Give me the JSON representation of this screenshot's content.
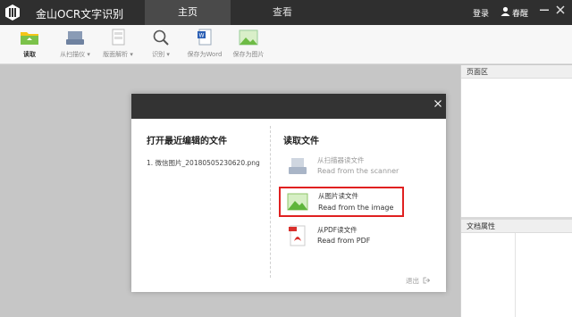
{
  "app": {
    "title": "金山OCR文字识别",
    "tabs": [
      {
        "label": "主页",
        "active": true
      },
      {
        "label": "查看",
        "active": false
      }
    ],
    "login_label": "登录",
    "username": "春醒"
  },
  "toolbar": {
    "items": [
      {
        "label": "读取",
        "icon": "folder-icon",
        "active": true
      },
      {
        "label": "从扫描仪",
        "icon": "scanner-icon",
        "dropdown": true
      },
      {
        "label": "版面解析",
        "icon": "layout-icon",
        "dropdown": true
      },
      {
        "label": "识别",
        "icon": "search-icon",
        "dropdown": true
      },
      {
        "label": "保存为Word",
        "icon": "word-icon"
      },
      {
        "label": "保存为图片",
        "icon": "image-icon"
      }
    ]
  },
  "right_panel": {
    "pages_title": "页面区",
    "props_title": "文档属性"
  },
  "dialog": {
    "recent_title": "打开最近编辑的文件",
    "recent_files": [
      "1.  微信图片_20180505230620.png"
    ],
    "read_title": "读取文件",
    "options": [
      {
        "cn": "从扫描器读文件",
        "en": "Read from the scanner",
        "icon": "scanner-icon",
        "enabled": false
      },
      {
        "cn": "从图片读文件",
        "en": "Read from the image",
        "icon": "image-icon",
        "highlighted": true
      },
      {
        "cn": "从PDF读文件",
        "en": "Read from PDF",
        "icon": "pdf-icon"
      }
    ],
    "exit_label": "退出"
  },
  "colors": {
    "titlebar": "#2f2f2f",
    "highlight_border": "#e02020",
    "workspace": "#c6c6c6"
  }
}
